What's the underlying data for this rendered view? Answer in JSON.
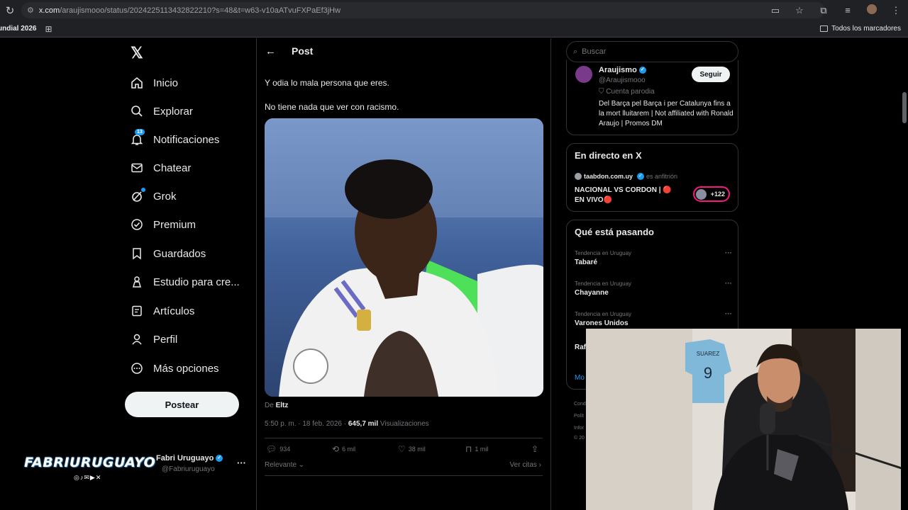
{
  "browser": {
    "url_host": "x.com",
    "url_path": "/araujismooo/status/2024225113432822210?s=48&t=w63-v10aATvuFXPaEf3jHw",
    "bookmark_first": "undial 2026",
    "bookmark_all": "Todos los marcadores"
  },
  "nav": {
    "items": [
      {
        "label": "Inicio",
        "icon": "home-icon"
      },
      {
        "label": "Explorar",
        "icon": "search-icon"
      },
      {
        "label": "Notificaciones",
        "icon": "bell-icon",
        "badge": "13"
      },
      {
        "label": "Chatear",
        "icon": "mail-icon"
      },
      {
        "label": "Grok",
        "icon": "grok-icon"
      },
      {
        "label": "Premium",
        "icon": "verified-icon"
      },
      {
        "label": "Guardados",
        "icon": "bookmark-icon"
      },
      {
        "label": "Estudio para cre...",
        "icon": "studio-icon"
      },
      {
        "label": "Artículos",
        "icon": "article-icon"
      },
      {
        "label": "Perfil",
        "icon": "person-icon"
      },
      {
        "label": "Más opciones",
        "icon": "more-circle-icon"
      }
    ],
    "post_button": "Postear"
  },
  "account": {
    "overlay_logo": "FABRIURUGUAYO",
    "name": "Fabri Uruguayo",
    "handle": "@Fabriuruguayo",
    "more": "···"
  },
  "post": {
    "header_title": "Post",
    "text_line1": "Y odia lo mala persona que eres.",
    "text_line2": "No tiene nada que ver con racismo.",
    "from_prefix": "De",
    "from_author": "Eltz",
    "timestamp": "5:50 p. m. · 18 feb. 2026 · ",
    "views_value": "645,7 mil",
    "views_label": "Visualizaciones",
    "stats": {
      "replies": "934",
      "reposts": "6 mil",
      "likes": "38 mil",
      "bookmarks": "1 mil"
    },
    "sort_label": "Relevante",
    "quotes_label": "Ver citas"
  },
  "sidebar": {
    "search_placeholder": "Buscar",
    "profile_card": {
      "name": "Araujismo",
      "handle": "@Araujismooo",
      "parody": "Cuenta parodia",
      "bio": "Del Barça pel Barça i per Catalunya fins a la mort lluitarem | Not affiliated with Ronald Araujo | Promos DM",
      "follow": "Seguir"
    },
    "live": {
      "title": "En directo en X",
      "host": "taabdon.com.uy",
      "host_suffix": "es anfitrión",
      "event": "NACIONAL VS CORDON | 🔴 EN VIVO🔴",
      "listeners": "+122"
    },
    "trends": {
      "title": "Qué está pasando",
      "items": [
        {
          "context": "Tendencia en Uruguay",
          "name": "Tabaré"
        },
        {
          "context": "Tendencia en Uruguay",
          "name": "Chayanne"
        },
        {
          "context": "Tendencia en Uruguay",
          "name": "Varones Unidos"
        },
        {
          "context": "",
          "name": "Raf"
        }
      ],
      "more": "Mo"
    },
    "footer": [
      "Cond",
      "Polít",
      "Infor",
      "© 20"
    ]
  },
  "webcam": {
    "jersey_name": "SUAREZ",
    "jersey_number": "9"
  }
}
